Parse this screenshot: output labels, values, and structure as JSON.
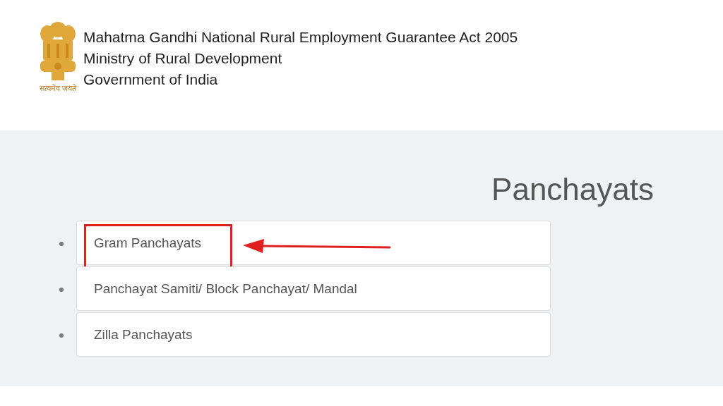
{
  "header": {
    "motto": "सत्यमेव जयते",
    "lines": [
      "Mahatma Gandhi National Rural Employment Guarantee Act 2005",
      "Ministry of Rural Development",
      "Government of India"
    ]
  },
  "heading": "Panchayats",
  "items": [
    {
      "label": "Gram Panchayats",
      "highlighted": true
    },
    {
      "label": "Panchayat Samiti/ Block Panchayat/ Mandal",
      "highlighted": false
    },
    {
      "label": "Zilla Panchayats",
      "highlighted": false
    }
  ]
}
